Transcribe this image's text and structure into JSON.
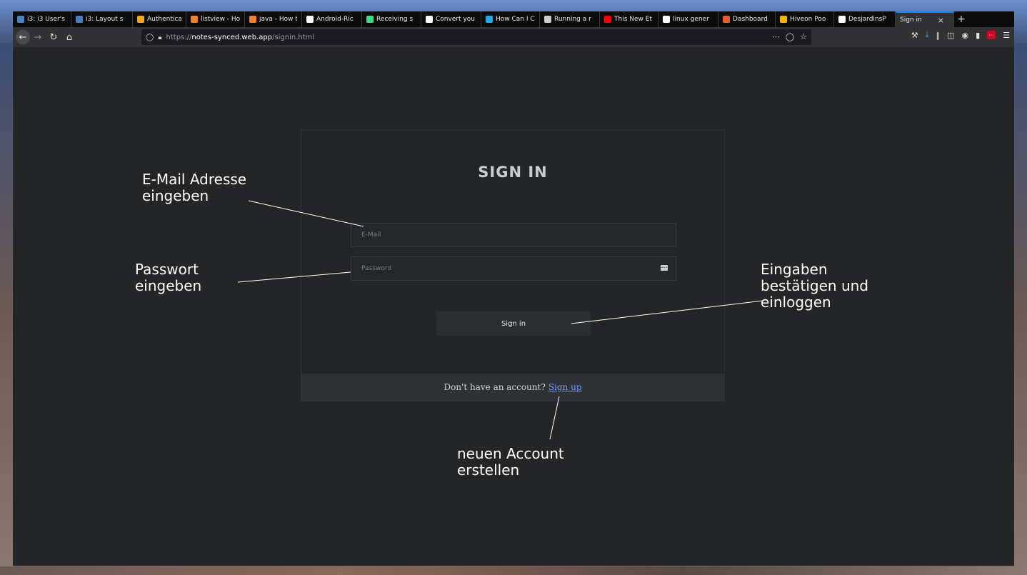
{
  "tabs": [
    {
      "label": "i3: i3 User's",
      "icon": "i3-icon",
      "color": "#4a7fc1"
    },
    {
      "label": "i3: Layout s",
      "icon": "i3-icon",
      "color": "#4a7fc1"
    },
    {
      "label": "Authenticat",
      "icon": "firebase-icon",
      "color": "#f5a623"
    },
    {
      "label": "listview - Ho",
      "icon": "stackoverflow-icon",
      "color": "#f48024"
    },
    {
      "label": "java - How t",
      "icon": "stackoverflow-icon",
      "color": "#f48024"
    },
    {
      "label": "Android-Ric",
      "icon": "github-icon",
      "color": "#ffffff"
    },
    {
      "label": "Receiving s",
      "icon": "android-icon",
      "color": "#3ddc84"
    },
    {
      "label": "Convert you",
      "icon": "medium-icon",
      "color": "#ffffff"
    },
    {
      "label": "How Can I C",
      "icon": "bracket-icon",
      "color": "#22a7f0"
    },
    {
      "label": "Running a r",
      "icon": "linux-icon",
      "color": "#cccccc"
    },
    {
      "label": "This New Et",
      "icon": "youtube-icon",
      "color": "#ff0000"
    },
    {
      "label": "linux gener",
      "icon": "google-icon",
      "color": "#ffffff"
    },
    {
      "label": "Dashboard",
      "icon": "hammer-icon",
      "color": "#e85d2a"
    },
    {
      "label": "Hiveon Poo",
      "icon": "hiveon-icon",
      "color": "#f7b500"
    },
    {
      "label": "DesjardinsP",
      "icon": "github-icon",
      "color": "#ffffff"
    },
    {
      "label": "Sign in",
      "icon": "",
      "color": "",
      "active": true
    }
  ],
  "url": {
    "prefix": "https://",
    "host": "notes-synced.web.app",
    "path": "/signin.html"
  },
  "card": {
    "title": "SIGN IN",
    "email_placeholder": "E-Mail",
    "password_placeholder": "Password",
    "signin_label": "Sign in",
    "footer_text": "Don't have an account?",
    "signup_label": "Sign up"
  },
  "annotations": {
    "email": [
      "E-Mail Adresse",
      "eingeben"
    ],
    "password": [
      "Passwort",
      "eingeben"
    ],
    "signin": [
      "Eingaben",
      "bestätigen und",
      "einloggen"
    ],
    "signup": [
      "neuen Account",
      "erstellen"
    ]
  },
  "colors": {
    "accent_tab": "#0a84ff",
    "link": "#6f9cf2",
    "page_bg": "#232527"
  }
}
